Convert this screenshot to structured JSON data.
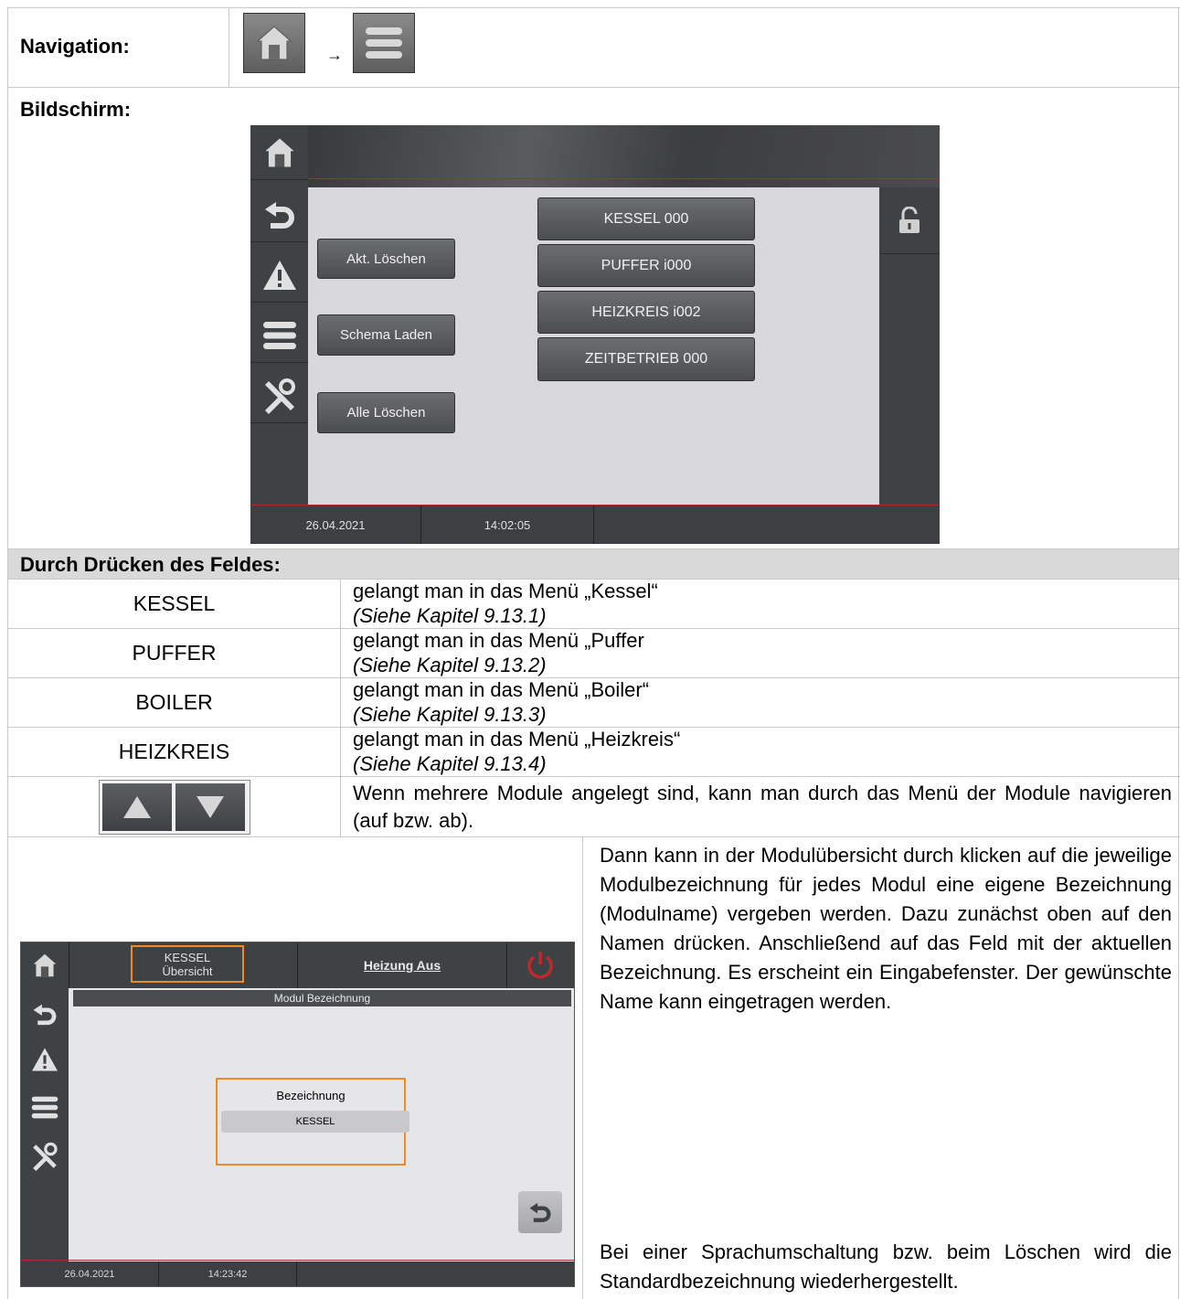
{
  "navigation": {
    "label": "Navigation:",
    "arrow": "→",
    "icons": [
      "home-icon",
      "menu-icon"
    ]
  },
  "screen_label": "Bildschirm:",
  "screen1": {
    "buttons_left": [
      "Akt. Löschen",
      "Schema Laden",
      "Alle Löschen"
    ],
    "modules": [
      "KESSEL 000",
      "PUFFER i000",
      "HEIZKREIS i002",
      "ZEITBETRIEB 000"
    ],
    "date": "26.04.2021",
    "time": "14:02:05",
    "sidebar_icons": [
      "home-icon",
      "back-icon",
      "warning-icon",
      "menu-icon",
      "tools-icon"
    ],
    "right_icon": "unlock-icon"
  },
  "press_heading": "Durch Drücken des Feldes:",
  "rows": [
    {
      "field": "KESSEL",
      "text": "gelangt man in das Menü „Kessel“",
      "ref": "(Siehe Kapitel 9.13.1)"
    },
    {
      "field": "PUFFER",
      "text": "gelangt man in das Menü „Puffer",
      "ref": "(Siehe Kapitel 9.13.2)"
    },
    {
      "field": "BOILER",
      "text": "gelangt man in das Menü „Boiler“",
      "ref": "(Siehe Kapitel 9.13.3)"
    },
    {
      "field": "HEIZKREIS",
      "text": "gelangt man in das Menü „Heizkreis“",
      "ref": "(Siehe Kapitel 9.13.4)"
    }
  ],
  "arrows_row": {
    "icons": [
      "arrow-up-icon",
      "arrow-down-icon"
    ],
    "text": "Wenn mehrere Module angelegt sind, kann man durch das Menü der Module navigieren (auf bzw. ab)."
  },
  "screen2": {
    "header_title": "KESSEL",
    "header_sub": "Übersicht",
    "header_status": "Heizung Aus",
    "panel_title": "Modul Bezeichnung",
    "box_label": "Bezeichnung",
    "box_value": "KESSEL",
    "date": "26.04.2021",
    "time": "14:23:42",
    "power_icon": "power-icon",
    "back_icon": "back-icon"
  },
  "desc_para1": "Dann kann in der Modulübersicht durch klicken auf die jeweilige Modulbezeichnung für jedes Modul eine eigene Bezeichnung (Modulname) vergeben werden. Dazu zunächst oben auf den Namen drücken. Anschließend auf das Feld mit der aktuellen Bezeichnung. Es erscheint ein Eingabefenster. Der gewünschte Name kann eingetragen werden.",
  "desc_para2": "Bei einer Sprachumschaltung bzw. beim Löschen wird die Standardbezeichnung wiederhergestellt.",
  "colors": {
    "accent_red": "#b3282a",
    "highlight_orange": "#f08a24",
    "header_gray": "#d9d9d9"
  }
}
